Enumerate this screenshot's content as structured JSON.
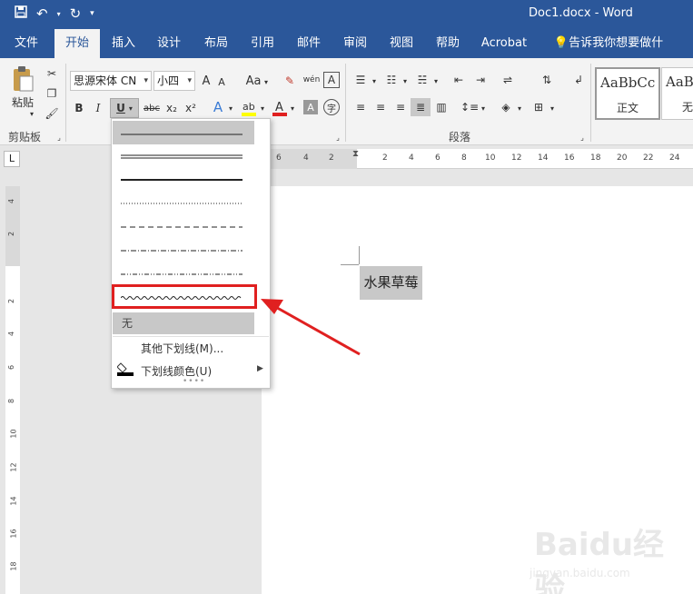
{
  "window": {
    "title": "Doc1.docx  -  Word"
  },
  "quick_access": {
    "save_icon": "save-icon",
    "undo_icon": "undo-icon",
    "redo_icon": "redo-icon",
    "customize_icon": "customize-icon"
  },
  "tabs": [
    {
      "label": "文件"
    },
    {
      "label": "开始"
    },
    {
      "label": "插入"
    },
    {
      "label": "设计"
    },
    {
      "label": "布局"
    },
    {
      "label": "引用"
    },
    {
      "label": "邮件"
    },
    {
      "label": "审阅"
    },
    {
      "label": "视图"
    },
    {
      "label": "帮助"
    },
    {
      "label": "Acrobat"
    },
    {
      "label": "告诉我你想要做什么"
    }
  ],
  "ribbon": {
    "clipboard": {
      "paste_label": "粘贴",
      "group_label": "剪贴板"
    },
    "font": {
      "font_name": "思源宋体 CN",
      "font_size": "小四",
      "bold": "B",
      "italic": "I",
      "underline": "U",
      "strikethrough": "abc",
      "subscript": "x₂",
      "superscript": "x²",
      "grow": "A",
      "shrink": "A",
      "case": "Aa",
      "phonetic": "wén",
      "font_color_icon": "font-color-icon",
      "highlight_icon": "highlight-icon"
    },
    "paragraph": {
      "group_label": "段落"
    },
    "styles": [
      {
        "sample": "AaBbCc",
        "name": "正文"
      },
      {
        "sample": "AaBb",
        "name": "无"
      }
    ]
  },
  "ruler": {
    "h_ticks": [
      "6",
      "4",
      "2",
      "2",
      "2",
      "4",
      "6",
      "8",
      "10",
      "12",
      "14",
      "16",
      "18",
      "20",
      "22",
      "24"
    ],
    "v_ticks": [
      "4",
      "2",
      "2",
      "2",
      "4",
      "6",
      "8",
      "10",
      "12",
      "14",
      "16",
      "18"
    ]
  },
  "underline_menu": {
    "styles": [
      "single",
      "double",
      "thick",
      "dotted",
      "dashed",
      "dash-dot",
      "dash-dot-dot",
      "wave"
    ],
    "none_label": "无",
    "more_label": "其他下划线(M)...",
    "color_label": "下划线颜色(U)"
  },
  "document": {
    "text": "水果草莓"
  },
  "watermark": {
    "text": "Baidu经验",
    "sub": "jingyan.baidu.com"
  },
  "colors": {
    "titlebar": "#2b579a",
    "annotation": "#e02020"
  }
}
